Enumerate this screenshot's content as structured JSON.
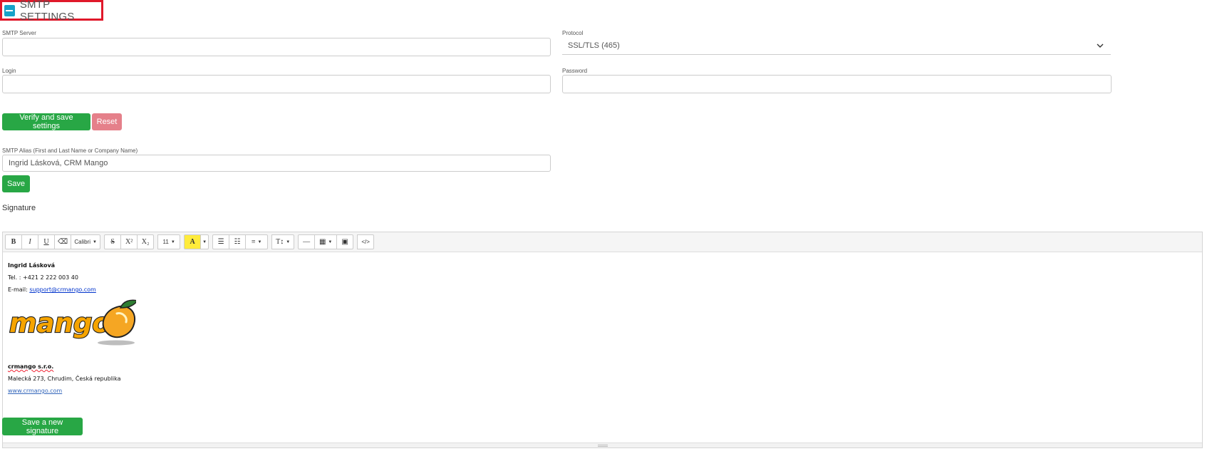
{
  "section": {
    "title": "SMTP SETTINGS"
  },
  "smtp_server": {
    "label": "SMTP Server",
    "value": ""
  },
  "protocol": {
    "label": "Protocol",
    "selected": "SSL/TLS (465)"
  },
  "login": {
    "label": "Login",
    "value": ""
  },
  "password": {
    "label": "Password",
    "value": ""
  },
  "buttons": {
    "verify_save": "Verify and save settings",
    "reset": "Reset",
    "save": "Save",
    "save_signature": "Save a new signature"
  },
  "alias": {
    "label": "SMTP Alias (First and Last Name or Company Name)",
    "value": "Ingrid Lásková, CRM Mango"
  },
  "signature": {
    "label": "Signature",
    "toolbar": {
      "bold": "B",
      "italic": "I",
      "underline": "U",
      "eraser": "⌫",
      "font": "Calibri",
      "strike": "S",
      "superscript": "X²",
      "subscript": "X₂",
      "size": "11",
      "highlight": "A",
      "ul": "☰",
      "ol": "☷",
      "align": "≡",
      "height": "T↕",
      "hr": "—",
      "table": "▦",
      "picture": "▣",
      "code": "</>"
    },
    "content": {
      "name": "Ingrid Lásková",
      "phone": "Tel. : +421 2 222 003 40",
      "email_label": "E-mail: ",
      "email": "support@crmango.com",
      "logo_text": "mango",
      "company": "crmango s.r.o.",
      "address": "Malecká 273, Chrudim, Česká republika",
      "website": "www.crmango.com"
    }
  },
  "colors": {
    "green": "#28a745",
    "reset": "#e5808a",
    "accent": "#17a2c8",
    "highlight": "#e0182a"
  }
}
